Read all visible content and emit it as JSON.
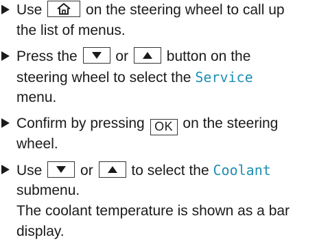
{
  "colors": {
    "text": "#1a1a1a",
    "menu_highlight": "#1f8fb0"
  },
  "icons": {
    "bullet": "right-pointing-triangle",
    "home": "home-icon",
    "down": "down-arrow-button",
    "up": "up-arrow-button"
  },
  "steps": [
    {
      "line1_a": "Use",
      "line1_b": "on the steering wheel to call up",
      "line2": "the list of menus."
    },
    {
      "line1_a": "Press the",
      "line1_or": "or",
      "line1_b": "button on the",
      "line2_a": "steering wheel to select the",
      "line2_menu": "Service",
      "line3": "menu."
    },
    {
      "line1_a": "Confirm by pressing",
      "ok_label": "OK",
      "line1_b": "on the steering",
      "line2": "wheel."
    },
    {
      "line1_a": "Use",
      "line1_or": "or",
      "line1_b": "to select the",
      "line1_menu": "Coolant",
      "line2": "submenu.",
      "line3": "The coolant temperature is shown as a bar",
      "line4": "display."
    }
  ]
}
